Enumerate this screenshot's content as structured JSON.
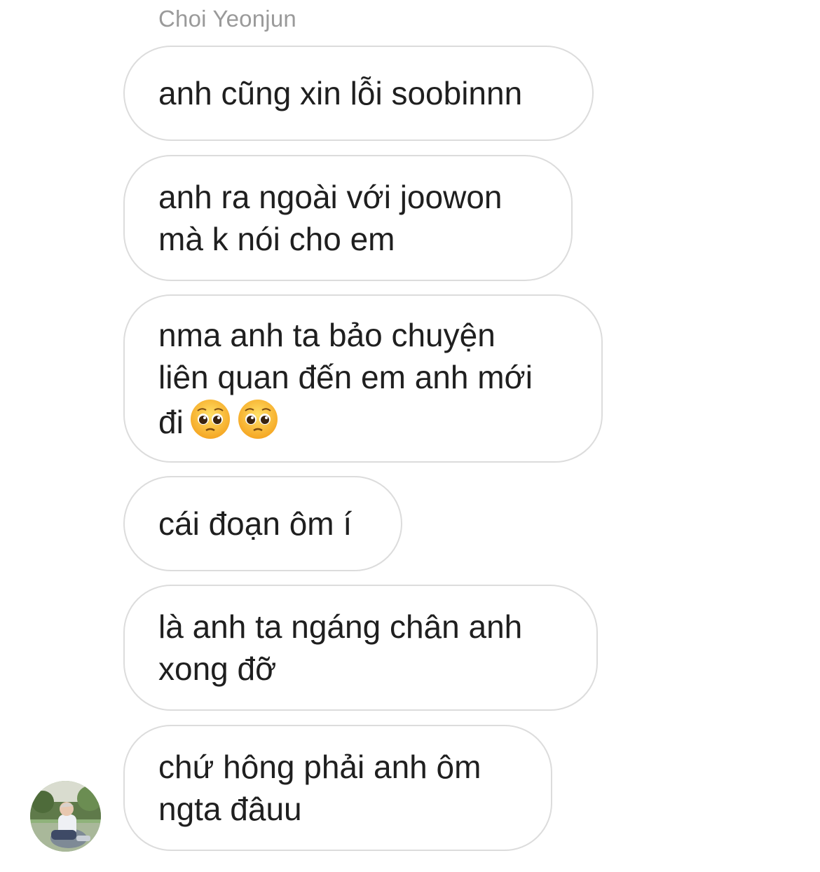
{
  "thread": {
    "sender_name": "Choi Yeonjun",
    "avatar_icon": "avatar-photo-icon",
    "messages": [
      {
        "text": "anh cũng xin lỗi soobinnn"
      },
      {
        "text": "anh ra ngoài với joowon\nmà k nói cho em"
      },
      {
        "text": "nma anh ta bảo chuyện\nliên quan đến em anh mới\nđi",
        "emojis": [
          "pleading-face-icon",
          "pleading-face-icon"
        ]
      },
      {
        "text": "cái đoạn ôm í"
      },
      {
        "text": "là anh ta ngáng chân anh\nxong đỡ"
      },
      {
        "text": "chứ hông phải anh ôm\nngta đâuu"
      }
    ]
  },
  "colors": {
    "bubble_border": "#dcdcdc",
    "sender_name": "#9a9a9a",
    "text": "#1f1f1f",
    "background": "#ffffff"
  }
}
